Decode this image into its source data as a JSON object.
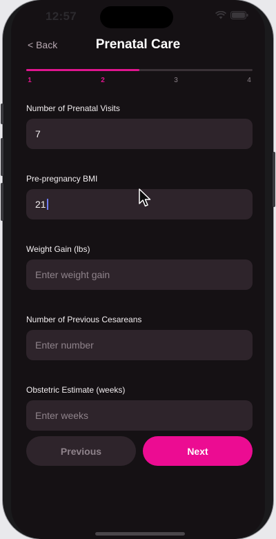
{
  "status_bar": {
    "time": "12:57"
  },
  "header": {
    "back_label": "< Back",
    "title": "Prenatal Care"
  },
  "progress": {
    "steps": [
      "1",
      "2",
      "3",
      "4"
    ],
    "current_step": 2,
    "fill_fraction": 0.5
  },
  "fields": [
    {
      "label": "Number of Prenatal Visits",
      "value": "7",
      "placeholder": ""
    },
    {
      "label": "Pre-pregnancy BMI",
      "value": "21",
      "placeholder": ""
    },
    {
      "label": "Weight Gain (lbs)",
      "value": "",
      "placeholder": "Enter weight gain"
    },
    {
      "label": "Number of Previous Cesareans",
      "value": "",
      "placeholder": "Enter number"
    },
    {
      "label": "Obstetric Estimate (weeks)",
      "value": "",
      "placeholder": "Enter weeks"
    }
  ],
  "buttons": {
    "previous": "Previous",
    "next": "Next"
  },
  "colors": {
    "accent": "#ec0c92",
    "background": "#151114",
    "input_bg": "#2e242b"
  }
}
